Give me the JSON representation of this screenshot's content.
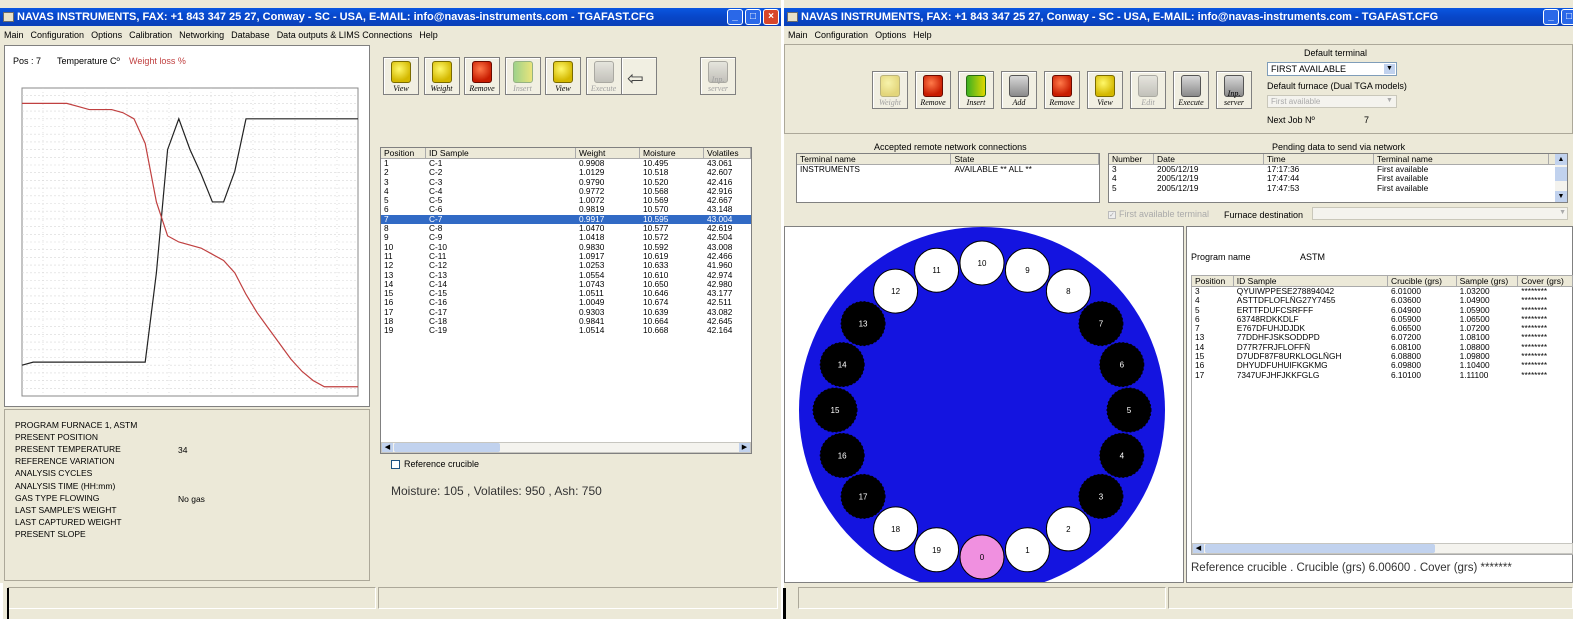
{
  "colors": {
    "title": "#0a56e0",
    "select": "#316ac5",
    "chart_black": "#222222",
    "chart_red": "#c04040",
    "carousel_blue": "#1414e0",
    "highlight": "#f090e0"
  },
  "left": {
    "title": "NAVAS INSTRUMENTS, FAX: +1 843 347 25 27, Conway - SC - USA, E-MAIL: info@navas-instruments.com - TGAFAST.CFG",
    "menu": [
      "Main",
      "Configuration",
      "Options",
      "Calibration",
      "Networking",
      "Database",
      "Data outputs & LIMS Connections",
      "Help"
    ],
    "chart_header": {
      "pos": "Pos : 7",
      "temp": "Temperature Cº",
      "weight": "Weight loss %"
    },
    "toolbar": [
      {
        "label": "View",
        "icon": "magnifier-icon",
        "style": "g-yellow",
        "disabled": false
      },
      {
        "label": "Weight",
        "icon": "crucible-add-icon",
        "style": "g-yellow",
        "disabled": false
      },
      {
        "label": "Remove",
        "icon": "remove-crucible-icon",
        "style": "g-red",
        "disabled": false
      },
      {
        "label": "Insert",
        "icon": "insert-crucible-icon",
        "style": "g-green",
        "disabled": true
      },
      {
        "label": "View",
        "icon": "magnifier-icon",
        "style": "g-yellow",
        "disabled": false
      },
      {
        "label": "Execute",
        "icon": "traffic-light-icon",
        "style": "g-grey",
        "disabled": true
      }
    ],
    "back_icon": "back-arrow-icon",
    "net_icon": "network-server-icon",
    "net_label": "Inp. server",
    "table": {
      "headers": [
        "Position",
        "ID Sample",
        "Weight",
        "Moisture",
        "Volatiles"
      ],
      "selected_index": 6,
      "rows": [
        [
          "1",
          "C-1",
          "0.9908",
          "10.495",
          "43.061"
        ],
        [
          "2",
          "C-2",
          "1.0129",
          "10.518",
          "42.607"
        ],
        [
          "3",
          "C-3",
          "0.9790",
          "10.520",
          "42.416"
        ],
        [
          "4",
          "C-4",
          "0.9772",
          "10.568",
          "42.916"
        ],
        [
          "5",
          "C-5",
          "1.0072",
          "10.569",
          "42.667"
        ],
        [
          "6",
          "C-6",
          "0.9819",
          "10.570",
          "43.148"
        ],
        [
          "7",
          "C-7",
          "0.9917",
          "10.595",
          "43.004"
        ],
        [
          "8",
          "C-8",
          "1.0470",
          "10.577",
          "42.619"
        ],
        [
          "9",
          "C-9",
          "1.0418",
          "10.572",
          "42.504"
        ],
        [
          "10",
          "C-10",
          "0.9830",
          "10.592",
          "43.008"
        ],
        [
          "11",
          "C-11",
          "1.0917",
          "10.619",
          "42.466"
        ],
        [
          "12",
          "C-12",
          "1.0253",
          "10.633",
          "41.960"
        ],
        [
          "13",
          "C-13",
          "1.0554",
          "10.610",
          "42.974"
        ],
        [
          "14",
          "C-14",
          "1.0743",
          "10.650",
          "42.980"
        ],
        [
          "15",
          "C-15",
          "1.0511",
          "10.646",
          "43.177"
        ],
        [
          "16",
          "C-16",
          "1.0049",
          "10.674",
          "42.511"
        ],
        [
          "17",
          "C-17",
          "0.9303",
          "10.639",
          "43.082"
        ],
        [
          "18",
          "C-18",
          "0.9841",
          "10.664",
          "42.645"
        ],
        [
          "19",
          "C-19",
          "1.0514",
          "10.668",
          "42.164"
        ]
      ]
    },
    "reference_crucible": "Reference crucible",
    "summary": "Moisture: 105 , Volatiles: 950 , Ash: 750",
    "status_labels": [
      "PROGRAM   FURNACE 1, ASTM",
      "PRESENT POSITION",
      "PRESENT TEMPERATURE",
      "REFERENCE VARIATION",
      "ANALYSIS CYCLES",
      "ANALYSIS TIME (HH:mm)",
      "GAS TYPE FLOWING",
      "LAST SAMPLE'S WEIGHT",
      "LAST CAPTURED WEIGHT",
      "PRESENT SLOPE"
    ],
    "status_values": {
      "temperature": "34",
      "gas": "No gas"
    }
  },
  "right": {
    "title": "NAVAS INSTRUMENTS, FAX: +1 843 347 25 27, Conway - SC - USA, E-MAIL: info@navas-instruments.com - TGAFAST.CFG",
    "menu": [
      "Main",
      "Configuration",
      "Options",
      "Help"
    ],
    "toolbar": [
      {
        "label": "Weight",
        "icon": "crucible-add-icon",
        "style": "g-yellow",
        "disabled": true
      },
      {
        "label": "Remove",
        "icon": "remove-crucible-icon",
        "style": "g-red",
        "disabled": false
      },
      {
        "label": "Insert",
        "icon": "insert-crucible-icon",
        "style": "g-green",
        "disabled": false
      },
      {
        "label": "Add",
        "icon": "add-job-icon",
        "style": "g-grey",
        "disabled": false
      },
      {
        "label": "Remove",
        "icon": "remove-job-icon",
        "style": "g-red",
        "disabled": false
      },
      {
        "label": "View",
        "icon": "magnifier-icon",
        "style": "g-yellow",
        "disabled": false
      },
      {
        "label": "Edit",
        "icon": "edit-icon",
        "style": "g-grey",
        "disabled": true
      },
      {
        "label": "Execute",
        "icon": "traffic-light-icon",
        "style": "g-grey",
        "disabled": false
      },
      {
        "label": "Inp. server",
        "icon": "network-server-icon",
        "style": "g-grey",
        "disabled": false
      }
    ],
    "default_terminal_label": "Default terminal",
    "default_terminal_value": "FIRST AVAILABLE",
    "default_furnace_label": "Default furnace (Dual TGA models)",
    "default_furnace_value": "First available",
    "next_job_label": "Next Job Nº",
    "next_job_value": "7",
    "accepted_title": "Accepted remote network connections",
    "accepted_headers": [
      "Terminal name",
      "State"
    ],
    "accepted_rows": [
      [
        "INSTRUMENTS",
        "AVAILABLE   ** ALL **"
      ]
    ],
    "pending_title": "Pending data to send via network",
    "pending_headers": [
      "Number",
      "Date",
      "Time",
      "Terminal name"
    ],
    "pending_rows": [
      [
        "3",
        "2005/12/19",
        "17:17:36",
        "First available"
      ],
      [
        "4",
        "2005/12/19",
        "17:47:44",
        "First available"
      ],
      [
        "5",
        "2005/12/19",
        "17:47:53",
        "First available"
      ]
    ],
    "first_available_terminal": "First available terminal",
    "furnace_destination": "Furnace destination",
    "program_name_label": "Program name",
    "program_name_value": "ASTM",
    "sample_headers": [
      "Position",
      "ID Sample",
      "Crucible (grs)",
      "Sample (grs)",
      "Cover (grs)"
    ],
    "sample_rows": [
      [
        "3",
        "QYUIWPPESE278894042",
        "6.01000",
        "1.03200",
        "********"
      ],
      [
        "4",
        "ASTTDFLOFLÑG27Y7455",
        "6.03600",
        "1.04900",
        "********"
      ],
      [
        "5",
        "ERTTFDUFCSRFFF",
        "6.04900",
        "1.05900",
        "********"
      ],
      [
        "6",
        "63748RDKKDLF",
        "6.05900",
        "1.06500",
        "********"
      ],
      [
        "7",
        "E767DFUHJDJDK",
        "6.06500",
        "1.07200",
        "********"
      ],
      [
        "13",
        "77DDHFJSKSODDPD",
        "6.07200",
        "1.08100",
        "********"
      ],
      [
        "14",
        "D77R7FRJFLOFFÑ",
        "6.08100",
        "1.08800",
        "********"
      ],
      [
        "15",
        "D7UDF87F8URKLOGLÑGH",
        "6.08800",
        "1.09800",
        "********"
      ],
      [
        "16",
        "DHYUDFUHUIFKGKMG",
        "6.09800",
        "1.10400",
        "********"
      ],
      [
        "17",
        "7347UFJHFJKKFGLG",
        "6.10100",
        "1.11100",
        "********"
      ]
    ],
    "reference_text": "Reference crucible . Crucible (grs)  6.00600 . Cover (grs) *******",
    "carousel": {
      "positions": [
        "0",
        "1",
        "2",
        "3",
        "4",
        "5",
        "6",
        "7",
        "8",
        "9",
        "10",
        "11",
        "12",
        "13",
        "14",
        "15",
        "16",
        "17",
        "18",
        "19"
      ],
      "loaded": [
        "3",
        "4",
        "5",
        "6",
        "7",
        "13",
        "14",
        "15",
        "16",
        "17"
      ],
      "current": "0"
    }
  },
  "chart_data": {
    "type": "line",
    "title": "",
    "xlabel": "",
    "ylabel": "",
    "grid": true,
    "x": [
      0,
      1,
      2,
      3,
      4,
      5,
      6,
      7,
      8,
      9,
      10,
      11,
      12,
      13,
      14,
      15,
      16,
      17,
      18,
      19,
      20,
      21,
      22,
      23,
      24,
      25,
      26,
      27,
      28,
      29,
      30
    ],
    "series": [
      {
        "name": "Temperature Cº",
        "values": [
          10,
          11,
          11,
          11,
          11,
          11,
          11,
          11,
          11,
          11,
          11,
          11,
          40,
          80,
          90,
          80,
          72,
          63,
          63,
          73,
          90,
          90,
          90,
          90,
          90,
          90,
          90,
          90,
          90,
          90,
          90
        ]
      },
      {
        "name": "Weight loss %",
        "values": [
          95,
          95,
          95,
          95,
          95,
          94,
          93,
          93,
          93,
          92,
          90,
          82,
          63,
          52,
          50,
          49,
          48,
          46,
          44,
          40,
          33,
          27,
          22,
          17,
          12,
          8,
          5,
          3,
          3,
          3,
          3
        ]
      }
    ],
    "ylim": [
      0,
      100
    ]
  }
}
